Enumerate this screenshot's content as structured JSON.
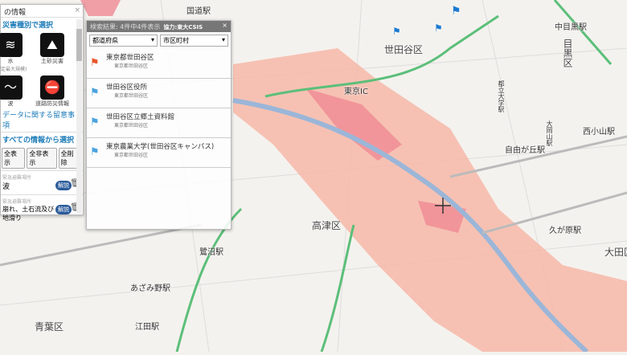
{
  "map": {
    "labels": [
      "世田谷区",
      "東京IC",
      "高津区",
      "青葉区",
      "目黒区",
      "大田区",
      "中目黒駅",
      "自由が丘駅",
      "西小山駅",
      "久が原駅",
      "都立大学駅",
      "あざみ野駅",
      "江田駅",
      "鷺沼駅",
      "大岡山駅",
      "国道駅"
    ],
    "colors": {
      "flood": "#f6b9a8",
      "flood_dark": "#f08a93",
      "river": "#9bb6d8",
      "road_green": "#5cbf7a"
    }
  },
  "left_panel": {
    "title": "の情報",
    "section_type": "災害種別で選択",
    "icons": [
      {
        "name": "flood-icon",
        "label": "水",
        "sub": "(想定最大規模)"
      },
      {
        "name": "landslide-icon",
        "label": "土砂災害",
        "sub": ""
      },
      {
        "name": "tsunami-icon",
        "label": "波",
        "sub": ""
      },
      {
        "name": "road-disaster-icon",
        "label": "道路防災情報",
        "sub": ""
      }
    ],
    "notes_link": "データに関する留意事項",
    "section_all": "すべての情報から選択",
    "buttons": [
      "全表示",
      "全非表示",
      "全削除"
    ],
    "items": [
      {
        "small": "緊急避難場所",
        "text": "波",
        "badge": "解説"
      },
      {
        "small": "緊急避難場所",
        "text": "崩れ、土石流及び地滑り",
        "badge": "解説"
      }
    ]
  },
  "results": {
    "header": "検索結果: 4件中4件表示",
    "credit": "協力:東大CSIS",
    "pref_select": "都道府県",
    "city_select": "市区町村",
    "items": [
      {
        "title": "東京都世田谷区",
        "sub": "東京都世田谷区",
        "flag_color": "#e8562a"
      },
      {
        "title": "世田谷区役所",
        "sub": "東京都世田谷区",
        "flag_color": "#4aa3df"
      },
      {
        "title": "世田谷区立郷土資料館",
        "sub": "東京都世田谷区",
        "flag_color": "#4aa3df"
      },
      {
        "title": "東京農業大学(世田谷区キャンパス)",
        "sub": "東京都世田谷区",
        "flag_color": "#4aa3df"
      }
    ]
  }
}
